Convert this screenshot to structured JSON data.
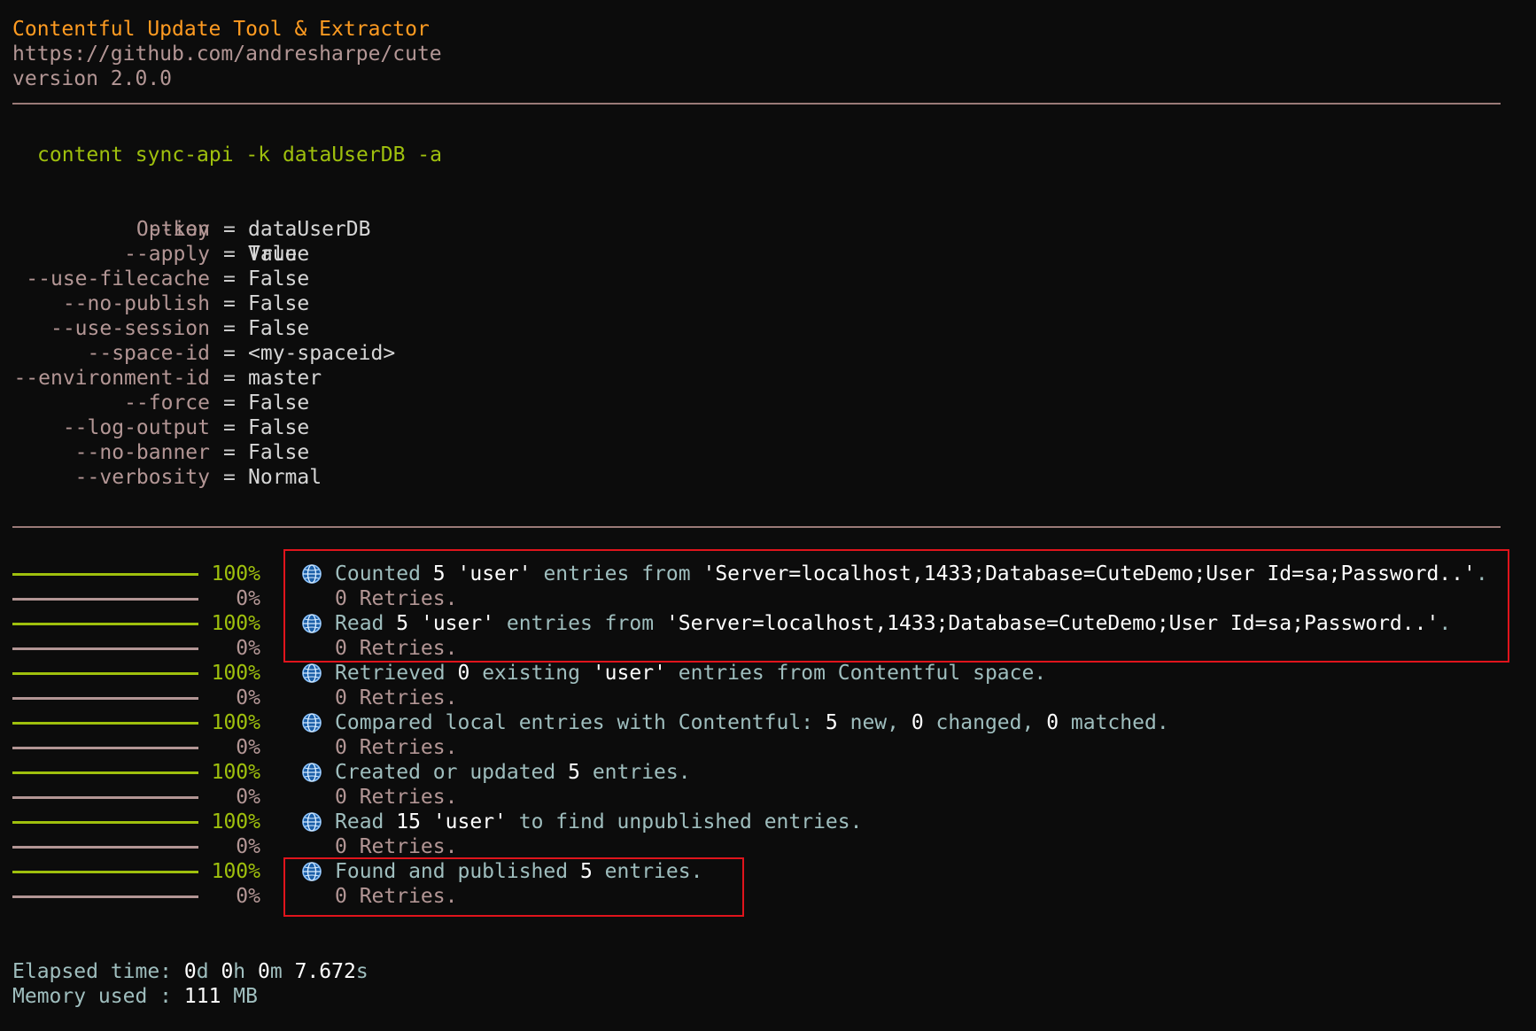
{
  "banner": {
    "title": "Contentful Update Tool & Extractor",
    "url": "https://github.com/andresharpe/cute",
    "version": "version 2.0.0"
  },
  "command": "content sync-api -k dataUserDB -a",
  "options_header": {
    "option": "Option",
    "value": "Value"
  },
  "options": [
    {
      "name": "--key",
      "eq": "=",
      "value": "dataUserDB"
    },
    {
      "name": "--apply",
      "eq": "=",
      "value": "True"
    },
    {
      "name": "--use-filecache",
      "eq": "=",
      "value": "False"
    },
    {
      "name": "--no-publish",
      "eq": "=",
      "value": "False"
    },
    {
      "name": "--use-session",
      "eq": "=",
      "value": "False"
    },
    {
      "name": "--space-id",
      "eq": "=",
      "value": "<my-spaceid>"
    },
    {
      "name": "--environment-id",
      "eq": "=",
      "value": "master"
    },
    {
      "name": "--force",
      "eq": "=",
      "value": "False"
    },
    {
      "name": "--log-output",
      "eq": "=",
      "value": "False"
    },
    {
      "name": "--no-banner",
      "eq": "=",
      "value": "False"
    },
    {
      "name": "--verbosity",
      "eq": "=",
      "value": "Normal"
    }
  ],
  "tasks": [
    {
      "progress_pct": "100%",
      "retry_pct": "0%",
      "parts": [
        "Counted ",
        "5",
        " ",
        "'user'",
        " entries from ",
        "'Server=localhost,1433;Database=CuteDemo;User Id=sa;Password..'",
        "."
      ],
      "retries": "0 Retries."
    },
    {
      "progress_pct": "100%",
      "retry_pct": "0%",
      "parts": [
        "Read ",
        "5",
        " ",
        "'user'",
        " entries from ",
        "'Server=localhost,1433;Database=CuteDemo;User Id=sa;Password..'",
        "."
      ],
      "retries": "0 Retries."
    },
    {
      "progress_pct": "100%",
      "retry_pct": "0%",
      "parts": [
        "Retrieved ",
        "0",
        " existing ",
        "'user'",
        " entries from Contentful space."
      ],
      "retries": "0 Retries."
    },
    {
      "progress_pct": "100%",
      "retry_pct": "0%",
      "parts": [
        "Compared local entries with Contentful: ",
        "5",
        " new, ",
        "0",
        " changed, ",
        "0",
        " matched."
      ],
      "retries": "0 Retries."
    },
    {
      "progress_pct": "100%",
      "retry_pct": "0%",
      "parts": [
        "Created or updated ",
        "5",
        " entries."
      ],
      "retries": "0 Retries."
    },
    {
      "progress_pct": "100%",
      "retry_pct": "0%",
      "parts": [
        "Read ",
        "15",
        " ",
        "'user'",
        " to find unpublished entries."
      ],
      "retries": "0 Retries."
    },
    {
      "progress_pct": "100%",
      "retry_pct": "0%",
      "parts": [
        "Found and published ",
        "5",
        " entries."
      ],
      "retries": "0 Retries."
    }
  ],
  "task_icon": "globe-icon",
  "stats": {
    "elapsed_label": "Elapsed time: ",
    "elapsed_d": "0",
    "elapsed_d_unit": "d ",
    "elapsed_h": "0",
    "elapsed_h_unit": "h ",
    "elapsed_m": "0",
    "elapsed_m_unit": "m ",
    "elapsed_s": "7.672",
    "elapsed_s_unit": "s",
    "memory_label": "Memory used : ",
    "memory_value": "111",
    "memory_unit": " MB"
  },
  "colors": {
    "background": "#0c0c0c",
    "title": "#ff9b21",
    "command": "#9fc00d",
    "muted": "#b39695",
    "message": "#9fbebe",
    "highlight_box": "#e0141c"
  }
}
